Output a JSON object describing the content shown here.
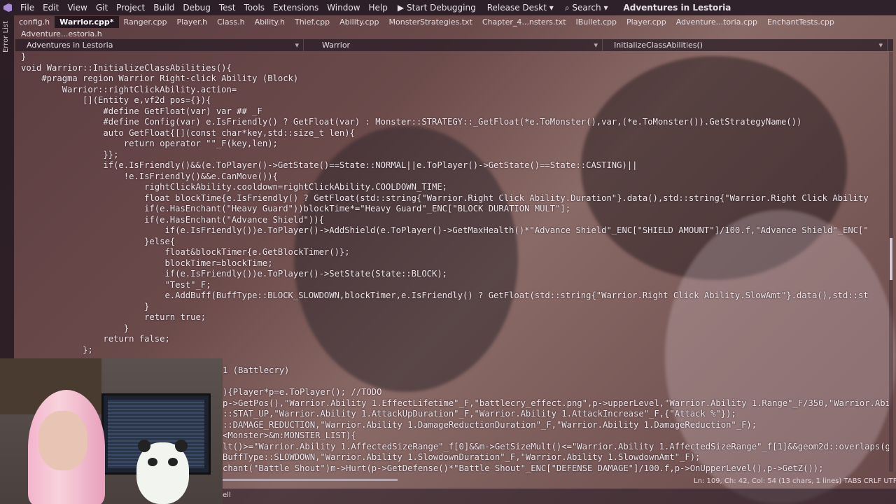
{
  "menubar": {
    "items": [
      "File",
      "Edit",
      "View",
      "Git",
      "Project",
      "Build",
      "Debug",
      "Test",
      "Tools",
      "Extensions",
      "Window",
      "Help"
    ],
    "start_debugging": "Start Debugging",
    "config": "Release Deskt",
    "search": "Search",
    "solution_title": "Adventures in Lestoria"
  },
  "sidebar": {
    "error_list": "Error List"
  },
  "tabs": [
    "config.h",
    "Warrior.cpp*",
    "Ranger.cpp",
    "Player.h",
    "Class.h",
    "Ability.h",
    "Thief.cpp",
    "Ability.cpp",
    "MonsterStrategies.txt",
    "Chapter_4...nsters.txt",
    "IBullet.cpp",
    "Player.cpp",
    "Adventure...toria.cpp",
    "EnchantTests.cpp"
  ],
  "tabs_row2": [
    "Adventure...estoria.h"
  ],
  "navbar": {
    "project": "Adventures in Lestoria",
    "scope": "Warrior",
    "member": "InitializeClassAbilities()"
  },
  "status": {
    "position": "Ln: 109, Ch: 42, Col: 54 (13 chars, 1 lines)  TABS  CRLF  UTF-8",
    "bottom_left": "ell"
  },
  "code_lines": [
    "}",
    "void Warrior::InitializeClassAbilities(){",
    "    #pragma region Warrior Right-click Ability (Block)",
    "        Warrior::rightClickAbility.action=",
    "            [](Entity e,vf2d pos={}){",
    "                #define GetFloat(var) var ## _F",
    "                #define Config(var) e.IsFriendly() ? GetFloat(var) : Monster::STRATEGY::_GetFloat(*e.ToMonster(),var,(*e.ToMonster()).GetStrategyName())",
    "                auto GetFloat{[](const char*key,std::size_t len){",
    "                    return operator \"\"_F(key,len);",
    "                }};",
    "                if(e.IsFriendly()&&(e.ToPlayer()->GetState()==State::NORMAL||e.ToPlayer()->GetState()==State::CASTING)||",
    "                    !e.IsFriendly()&&e.CanMove()){",
    "                        rightClickAbility.cooldown=rightClickAbility.COOLDOWN_TIME;",
    "                        float blockTime{e.IsFriendly() ? GetFloat(std::string{\"Warrior.Right Click Ability.Duration\"}.data(),std::string{\"Warrior.Right Click Ability",
    "                        if(e.HasEnchant(\"Heavy Guard\"))blockTime*=\"Heavy Guard\"_ENC[\"BLOCK DURATION MULT\"];",
    "                        if(e.HasEnchant(\"Advance Shield\")){",
    "                            if(e.IsFriendly())e.ToPlayer()->AddShield(e.ToPlayer()->GetMaxHealth()*\"Advance Shield\"_ENC[\"SHIELD AMOUNT\"]/100.f,\"Advance Shield\"_ENC[\"",
    "                        }else{",
    "                            float&blockTimer{e.GetBlockTimer()};",
    "                            blockTimer=blockTime;",
    "                            if(e.IsFriendly())e.ToPlayer()->SetState(State::BLOCK);",
    "                            \"Test\"_F;",
    "                            e.AddBuff(BuffType::BLOCK_SLOWDOWN,blockTimer,e.IsFriendly() ? GetFloat(std::string{\"Warrior.Right Click Ability.SlowAmt\"}.data(),std::st",
    "                        }",
    "                        return true;",
    "                    }",
    "                return false;",
    "            };"
  ],
  "code_lines_lower": [
    "1 (Battlecry)",
    "",
    "){Player*p=e.ToPlayer(); //TODO",
    "p->GetPos(),\"Warrior.Ability 1.EffectLifetime\"_F,\"battlecry_effect.png\",p->upperLevel,\"Warrior.Ability 1.Range\"_F/350,\"Warrior.Abi",
    "::STAT_UP,\"Warrior.Ability 1.AttackUpDuration\"_F,\"Warrior.Ability 1.AttackIncrease\"_F,{\"Attack %\"});",
    "::DAMAGE_REDUCTION,\"Warrior.Ability 1.DamageReductionDuration\"_F,\"Warrior.Ability 1.DamageReduction\"_F);",
    "<Monster>&m:MONSTER_LIST){",
    "lt()>=\"Warrior.Ability 1.AffectedSizeRange\"_f[0]&&m->GetSizeMult()<=\"Warrior.Ability 1.AffectedSizeRange\"_f[1]&&geom2d::overlaps(g",
    "BuffType::SLOWDOWN,\"Warrior.Ability 1.SlowdownDuration\"_F,\"Warrior.Ability 1.SlowdownAmt\"_F);",
    "chant(\"Battle Shout\")m->Hurt(p->GetDefense()*\"Battle Shout\"_ENC[\"DEFENSE DAMAGE\"]/100.f,p->OnUpperLevel(),p->GetZ());"
  ]
}
